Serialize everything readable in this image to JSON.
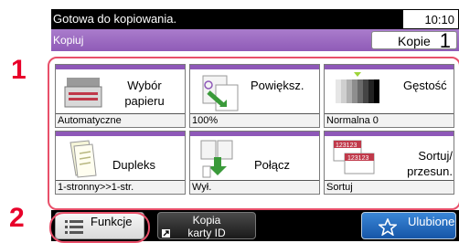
{
  "callouts": {
    "one": "1",
    "two": "2"
  },
  "status": {
    "message": "Gotowa do kopiowania.",
    "time": "10:10"
  },
  "header": {
    "title": "Kopiuj",
    "copies_label": "Kopie",
    "copies_value": "1"
  },
  "tiles": [
    {
      "label_line1": "Wybór",
      "label_line2": "papieru",
      "value": "Automatyczne",
      "icon": "paper-tray-icon"
    },
    {
      "label_line1": "Powiększ.",
      "label_line2": "",
      "value": "100%",
      "icon": "zoom-icon"
    },
    {
      "label_line1": "Gęstość",
      "label_line2": "",
      "value": "Normalna 0",
      "icon": "density-icon"
    },
    {
      "label_line1": "Dupleks",
      "label_line2": "",
      "value": "1-stronny>>1-str.",
      "icon": "duplex-icon"
    },
    {
      "label_line1": "Połącz",
      "label_line2": "",
      "value": "Wył.",
      "icon": "combine-icon"
    },
    {
      "label_line1": "Sortuj/",
      "label_line2": "przesun.",
      "value": "Sortuj",
      "icon": "collate-icon",
      "icon_text": "123123"
    }
  ],
  "bottom": {
    "funkcje": "Funkcje",
    "kopia_line1": "Kopia",
    "kopia_line2": "karty ID",
    "ulubione": "Ulubione"
  },
  "colors": {
    "accent_purple": "#8e58b8",
    "callout_red": "#e8002a",
    "favorite_blue": "#1f6cc4"
  }
}
